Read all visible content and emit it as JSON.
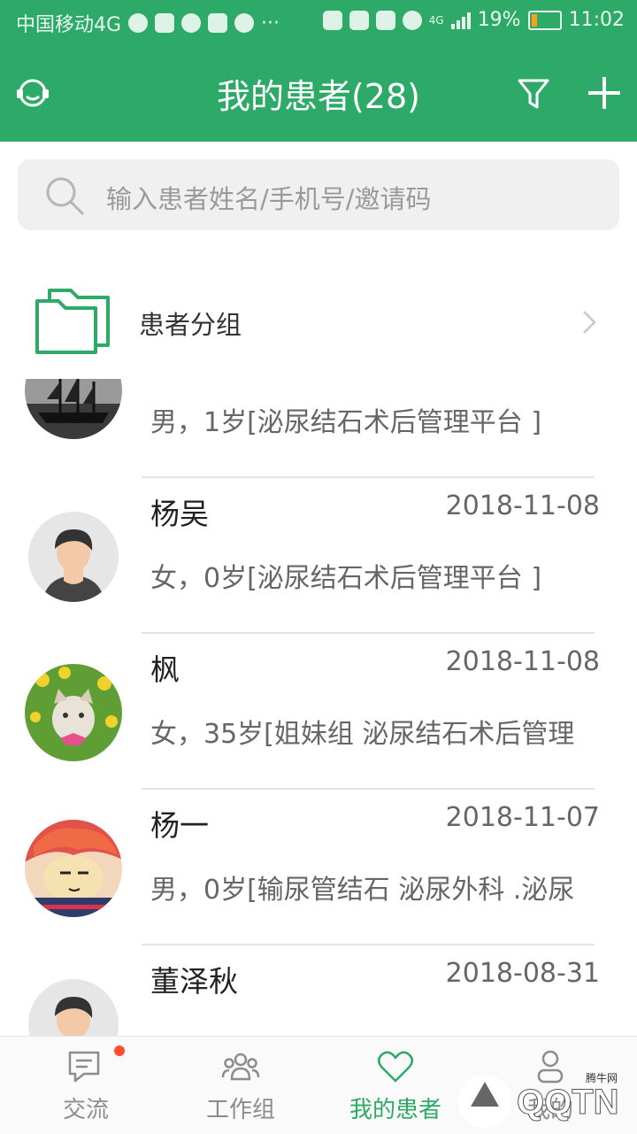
{
  "status_bar": {
    "carrier": "中国移动4G",
    "more": "···",
    "battery": "19%",
    "network": "4G",
    "time": "11:02"
  },
  "header": {
    "title": "我的患者(28)",
    "left_icon": "headset-icon",
    "filter_icon": "filter-icon",
    "add_icon": "plus-icon"
  },
  "search": {
    "placeholder": "输入患者姓名/手机号/邀请码",
    "icon": "search-icon"
  },
  "patient_group": {
    "label": "患者分组",
    "icon": "folder-icon"
  },
  "patients": [
    {
      "name": "",
      "date": "",
      "info": "男，1岁[泌尿结石术后管理平台 ]",
      "avatar": "ship-photo"
    },
    {
      "name": "杨吴",
      "date": "2018-11-08",
      "info": "女，0岁[泌尿结石术后管理平台 ]",
      "avatar": "default-person"
    },
    {
      "name": "枫",
      "date": "2018-11-08",
      "info": "女，35岁[姐妹组 泌尿结石术后管理",
      "avatar": "cat-photo"
    },
    {
      "name": "杨一",
      "date": "2018-11-07",
      "info": "男，0岁[输尿管结石 泌尿外科 .泌尿",
      "avatar": "cartoon-boy"
    },
    {
      "name": "董泽秋",
      "date": "2018-08-31",
      "info": "",
      "avatar": "default-person"
    }
  ],
  "tabs": [
    {
      "label": "交流",
      "icon": "chat-icon",
      "badge": true
    },
    {
      "label": "工作组",
      "icon": "group-icon",
      "badge": false
    },
    {
      "label": "我的患者",
      "icon": "heart-icon",
      "badge": false,
      "active": true
    },
    {
      "label": "我的",
      "icon": "user-icon",
      "badge": false
    }
  ],
  "watermark": "腾牛网",
  "colors": {
    "primary": "#2daa67",
    "badge": "#ff4d2e"
  }
}
